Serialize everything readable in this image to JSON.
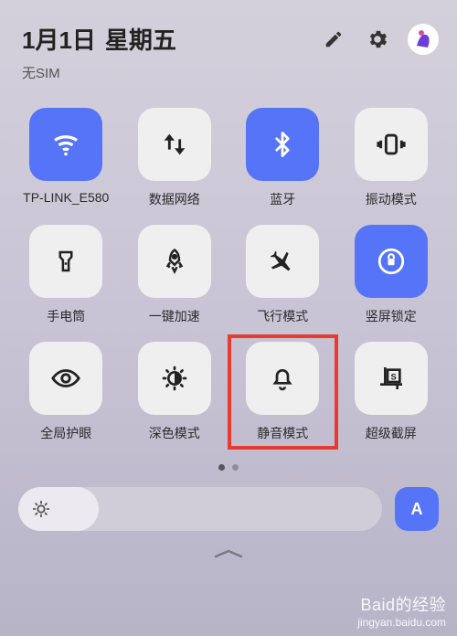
{
  "header": {
    "date": "1月1日",
    "weekday": "星期五",
    "sim_status": "无SIM"
  },
  "tiles": [
    {
      "label": "TP-LINK_E580",
      "icon": "wifi",
      "active": true
    },
    {
      "label": "数据网络",
      "icon": "data",
      "active": false
    },
    {
      "label": "蓝牙",
      "icon": "bluetooth",
      "active": true
    },
    {
      "label": "振动模式",
      "icon": "vibrate",
      "active": false
    },
    {
      "label": "手电筒",
      "icon": "flashlight",
      "active": false
    },
    {
      "label": "一键加速",
      "icon": "rocket",
      "active": false
    },
    {
      "label": "飞行模式",
      "icon": "airplane",
      "active": false
    },
    {
      "label": "竖屏锁定",
      "icon": "rotation-lock",
      "active": true
    },
    {
      "label": "全局护眼",
      "icon": "eye",
      "active": false
    },
    {
      "label": "深色模式",
      "icon": "dark-mode",
      "active": false
    },
    {
      "label": "静音模式",
      "icon": "mute",
      "active": false,
      "highlighted": true
    },
    {
      "label": "超级截屏",
      "icon": "screenshot",
      "active": false
    }
  ],
  "brightness": {
    "auto_label": "A",
    "percent": 22
  },
  "watermark": {
    "main": "Baid的经验",
    "sub": "jingyan.baidu.com"
  }
}
